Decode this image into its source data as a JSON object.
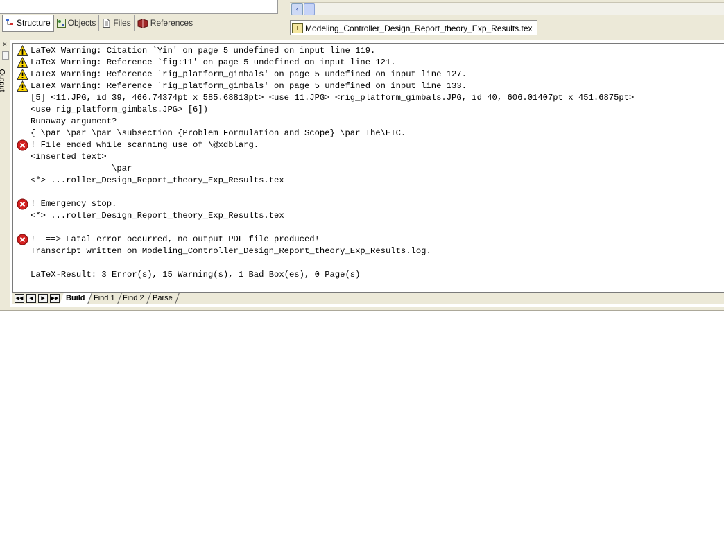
{
  "left_tabs": [
    {
      "label": "Structure",
      "icon": "structure-icon",
      "active": true
    },
    {
      "label": "Objects",
      "icon": "objects-icon",
      "active": false
    },
    {
      "label": "Files",
      "icon": "files-icon",
      "active": false
    },
    {
      "label": "References",
      "icon": "references-icon",
      "active": false
    }
  ],
  "editor": {
    "document_tab": "Modeling_Controller_Design_Report_theory_Exp_Results.tex"
  },
  "output_panel": {
    "label": "Output",
    "close_glyph": "×",
    "lines": [
      {
        "type": "warning",
        "text": "LaTeX Warning: Citation `Yin' on page 5 undefined on input line 119."
      },
      {
        "type": "warning",
        "text": "LaTeX Warning: Reference `fig:11' on page 5 undefined on input line 121."
      },
      {
        "type": "warning",
        "text": "LaTeX Warning: Reference `rig_platform_gimbals' on page 5 undefined on input line 127."
      },
      {
        "type": "warning",
        "text": "LaTeX Warning: Reference `rig_platform_gimbals' on page 5 undefined on input line 133."
      },
      {
        "type": "plain",
        "text": "[5] <11.JPG, id=39, 466.74374pt x 585.68813pt> <use 11.JPG> <rig_platform_gimbals.JPG, id=40, 606.01407pt x 451.6875pt>"
      },
      {
        "type": "plain",
        "text": "<use rig_platform_gimbals.JPG> [6])"
      },
      {
        "type": "plain",
        "text": "Runaway argument?"
      },
      {
        "type": "plain",
        "text": "{ \\par \\par \\par \\subsection {Problem Formulation and Scope} \\par The\\ETC."
      },
      {
        "type": "error",
        "text": "! File ended while scanning use of \\@xdblarg."
      },
      {
        "type": "plain",
        "text": "<inserted text>"
      },
      {
        "type": "plain",
        "text": "                \\par"
      },
      {
        "type": "plain",
        "text": "<*> ...roller_Design_Report_theory_Exp_Results.tex"
      },
      {
        "type": "plain",
        "text": ""
      },
      {
        "type": "error",
        "text": "! Emergency stop."
      },
      {
        "type": "plain",
        "text": "<*> ...roller_Design_Report_theory_Exp_Results.tex"
      },
      {
        "type": "plain",
        "text": ""
      },
      {
        "type": "error",
        "text": "!  ==> Fatal error occurred, no output PDF file produced!"
      },
      {
        "type": "plain",
        "text": "Transcript written on Modeling_Controller_Design_Report_theory_Exp_Results.log."
      },
      {
        "type": "plain",
        "text": ""
      },
      {
        "type": "plain",
        "text": "LaTeX-Result: 3 Error(s), 15 Warning(s), 1 Bad Box(es), 0 Page(s)"
      }
    ],
    "nav_buttons": [
      {
        "name": "first-icon",
        "glyph": "◀◀"
      },
      {
        "name": "previous-icon",
        "glyph": "◀"
      },
      {
        "name": "next-icon",
        "glyph": "▶"
      },
      {
        "name": "last-icon",
        "glyph": "▶▶"
      }
    ],
    "tabs": [
      {
        "label": "Build",
        "active": true
      },
      {
        "label": "Find 1",
        "active": false
      },
      {
        "label": "Find 2",
        "active": false
      },
      {
        "label": "Parse",
        "active": false
      }
    ]
  },
  "colors": {
    "chrome": "#ece9d8",
    "warning_yellow": "#ffd800",
    "error_red": "#d42020"
  }
}
